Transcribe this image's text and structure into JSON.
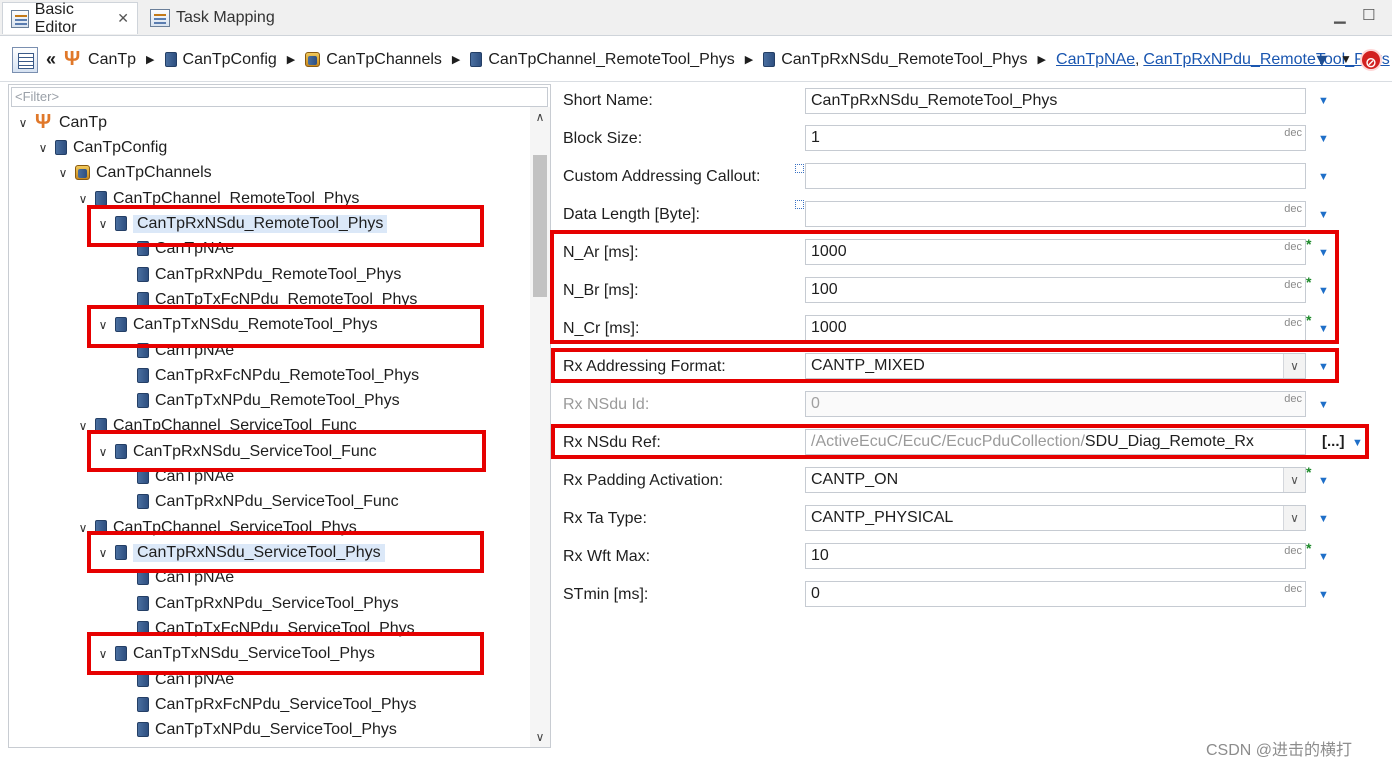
{
  "tabs": [
    {
      "label": "Basic Editor",
      "active": true
    },
    {
      "label": "Task Mapping",
      "active": false
    }
  ],
  "breadcrumb": {
    "items": [
      "CanTp",
      "CanTpConfig",
      "CanTpChannels",
      "CanTpChannel_RemoteTool_Phys",
      "CanTpRxNSdu_RemoteTool_Phys"
    ],
    "links": [
      "CanTpNAe",
      "CanTpRxNPdu_RemoteTool_Phys"
    ]
  },
  "tree": {
    "filter_placeholder": "<Filter>",
    "nodes": [
      "CanTp",
      "CanTpConfig",
      "CanTpChannels",
      "CanTpChannel_RemoteTool_Phys",
      "CanTpRxNSdu_RemoteTool_Phys",
      "CanTpNAe",
      "CanTpRxNPdu_RemoteTool_Phys",
      "CanTpTxFcNPdu_RemoteTool_Phys",
      "CanTpTxNSdu_RemoteTool_Phys",
      "CanTpNAe",
      "CanTpRxFcNPdu_RemoteTool_Phys",
      "CanTpTxNPdu_RemoteTool_Phys",
      "CanTpChannel_ServiceTool_Func",
      "CanTpRxNSdu_ServiceTool_Func",
      "CanTpNAe",
      "CanTpRxNPdu_ServiceTool_Func",
      "CanTpChannel_ServiceTool_Phys",
      "CanTpRxNSdu_ServiceTool_Phys",
      "CanTpNAe",
      "CanTpRxNPdu_ServiceTool_Phys",
      "CanTpTxFcNPdu_ServiceTool_Phys",
      "CanTpTxNSdu_ServiceTool_Phys",
      "CanTpNAe",
      "CanTpRxFcNPdu_ServiceTool_Phys",
      "CanTpTxNPdu_ServiceTool_Phys"
    ]
  },
  "properties": {
    "short_name": {
      "label": "Short Name:",
      "value": "CanTpRxNSdu_RemoteTool_Phys"
    },
    "block_size": {
      "label": "Block Size:",
      "value": "1"
    },
    "custom_addressing_callout": {
      "label": "Custom Addressing Callout:",
      "value": ""
    },
    "data_length": {
      "label": "Data Length [Byte]:",
      "value": ""
    },
    "n_ar": {
      "label": "N_Ar [ms]:",
      "value": "1000"
    },
    "n_br": {
      "label": "N_Br [ms]:",
      "value": "100"
    },
    "n_cr": {
      "label": "N_Cr [ms]:",
      "value": "1000"
    },
    "rx_addressing_format": {
      "label": "Rx Addressing Format:",
      "value": "CANTP_MIXED"
    },
    "rx_nsdu_id": {
      "label": "Rx NSdu Id:",
      "value": "0"
    },
    "rx_nsdu_ref": {
      "label": "Rx NSdu Ref:",
      "prefix": "/ActiveEcuC/EcuC/EcucPduCollection/",
      "value": "SDU_Diag_Remote_Rx"
    },
    "rx_padding_activation": {
      "label": "Rx Padding Activation:",
      "value": "CANTP_ON"
    },
    "rx_ta_type": {
      "label": "Rx Ta Type:",
      "value": "CANTP_PHYSICAL"
    },
    "rx_wft_max": {
      "label": "Rx Wft Max:",
      "value": "10"
    },
    "stmin": {
      "label": "STmin [ms]:",
      "value": "0"
    }
  },
  "unit_label": "dec",
  "browse_label": "[...]",
  "watermark": "CSDN @进击的横打",
  "colors": {
    "highlight": "#e60000",
    "link": "#1a56b0",
    "selection": "#dbe8f8",
    "dropdown_arrow": "#1f6fc8",
    "modified_star": "#1d8a2a"
  }
}
